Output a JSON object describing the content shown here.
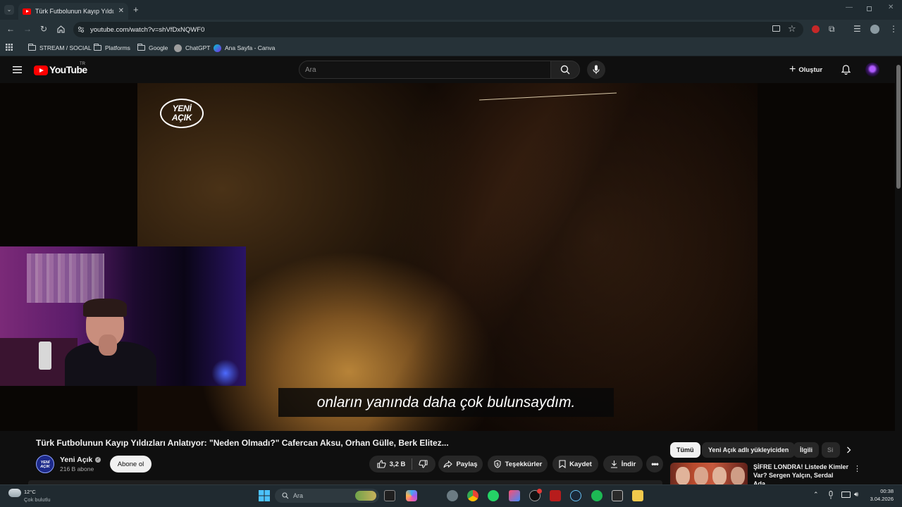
{
  "browser": {
    "tab_title": "Türk Futbolunun Kayıp Yıldızları Anlatıyor",
    "url": "youtube.com/watch?v=shVfDxNQWF0",
    "bookmarks": [
      "STREAM / SOCIAL",
      "Platforms",
      "Google",
      "ChatGPT",
      "Ana Sayfa - Canva"
    ]
  },
  "youtube": {
    "logo_text": "YouTube",
    "country_code": "TR",
    "search_placeholder": "Ara",
    "create_label": "Oluştur"
  },
  "video": {
    "channel_watermark_line1": "YENİ",
    "channel_watermark_line2": "AÇIK",
    "subtitle": "onların yanında daha çok bulunsaydım.",
    "title": "Türk Futbolunun Kayıp Yıldızları Anlatıyor: \"Neden Olmadı?\" Cafercan Aksu, Orhan Gülle, Berk Elitez..."
  },
  "channel": {
    "avatar_text": "YENİ AÇIK",
    "name": "Yeni Açık",
    "subscribers": "216 B abone",
    "subscribe_label": "Abone ol"
  },
  "actions": {
    "likes": "3,2 B",
    "share": "Paylaş",
    "thanks": "Teşekkürler",
    "save": "Kaydet",
    "download": "İndir"
  },
  "sidebar": {
    "chips": [
      "Tümü",
      "Yeni Açık adlı yükleyiciden",
      "İlgili",
      "Si"
    ],
    "active_chip": "Tümü",
    "recommendation_title": "ŞİFRE LONDRA! Listede Kimler Var? Sergen Yalçın, Serdal Ada..."
  },
  "taskbar": {
    "weather_temp": "12°C",
    "weather_desc": "Çok bulutlu",
    "search_placeholder": "Ara",
    "time": "00:38",
    "date": "3.04.2026"
  },
  "colors": {
    "youtube_red": "#ff0000",
    "browser_chrome": "#263238",
    "page_bg": "#0f0f0f"
  }
}
